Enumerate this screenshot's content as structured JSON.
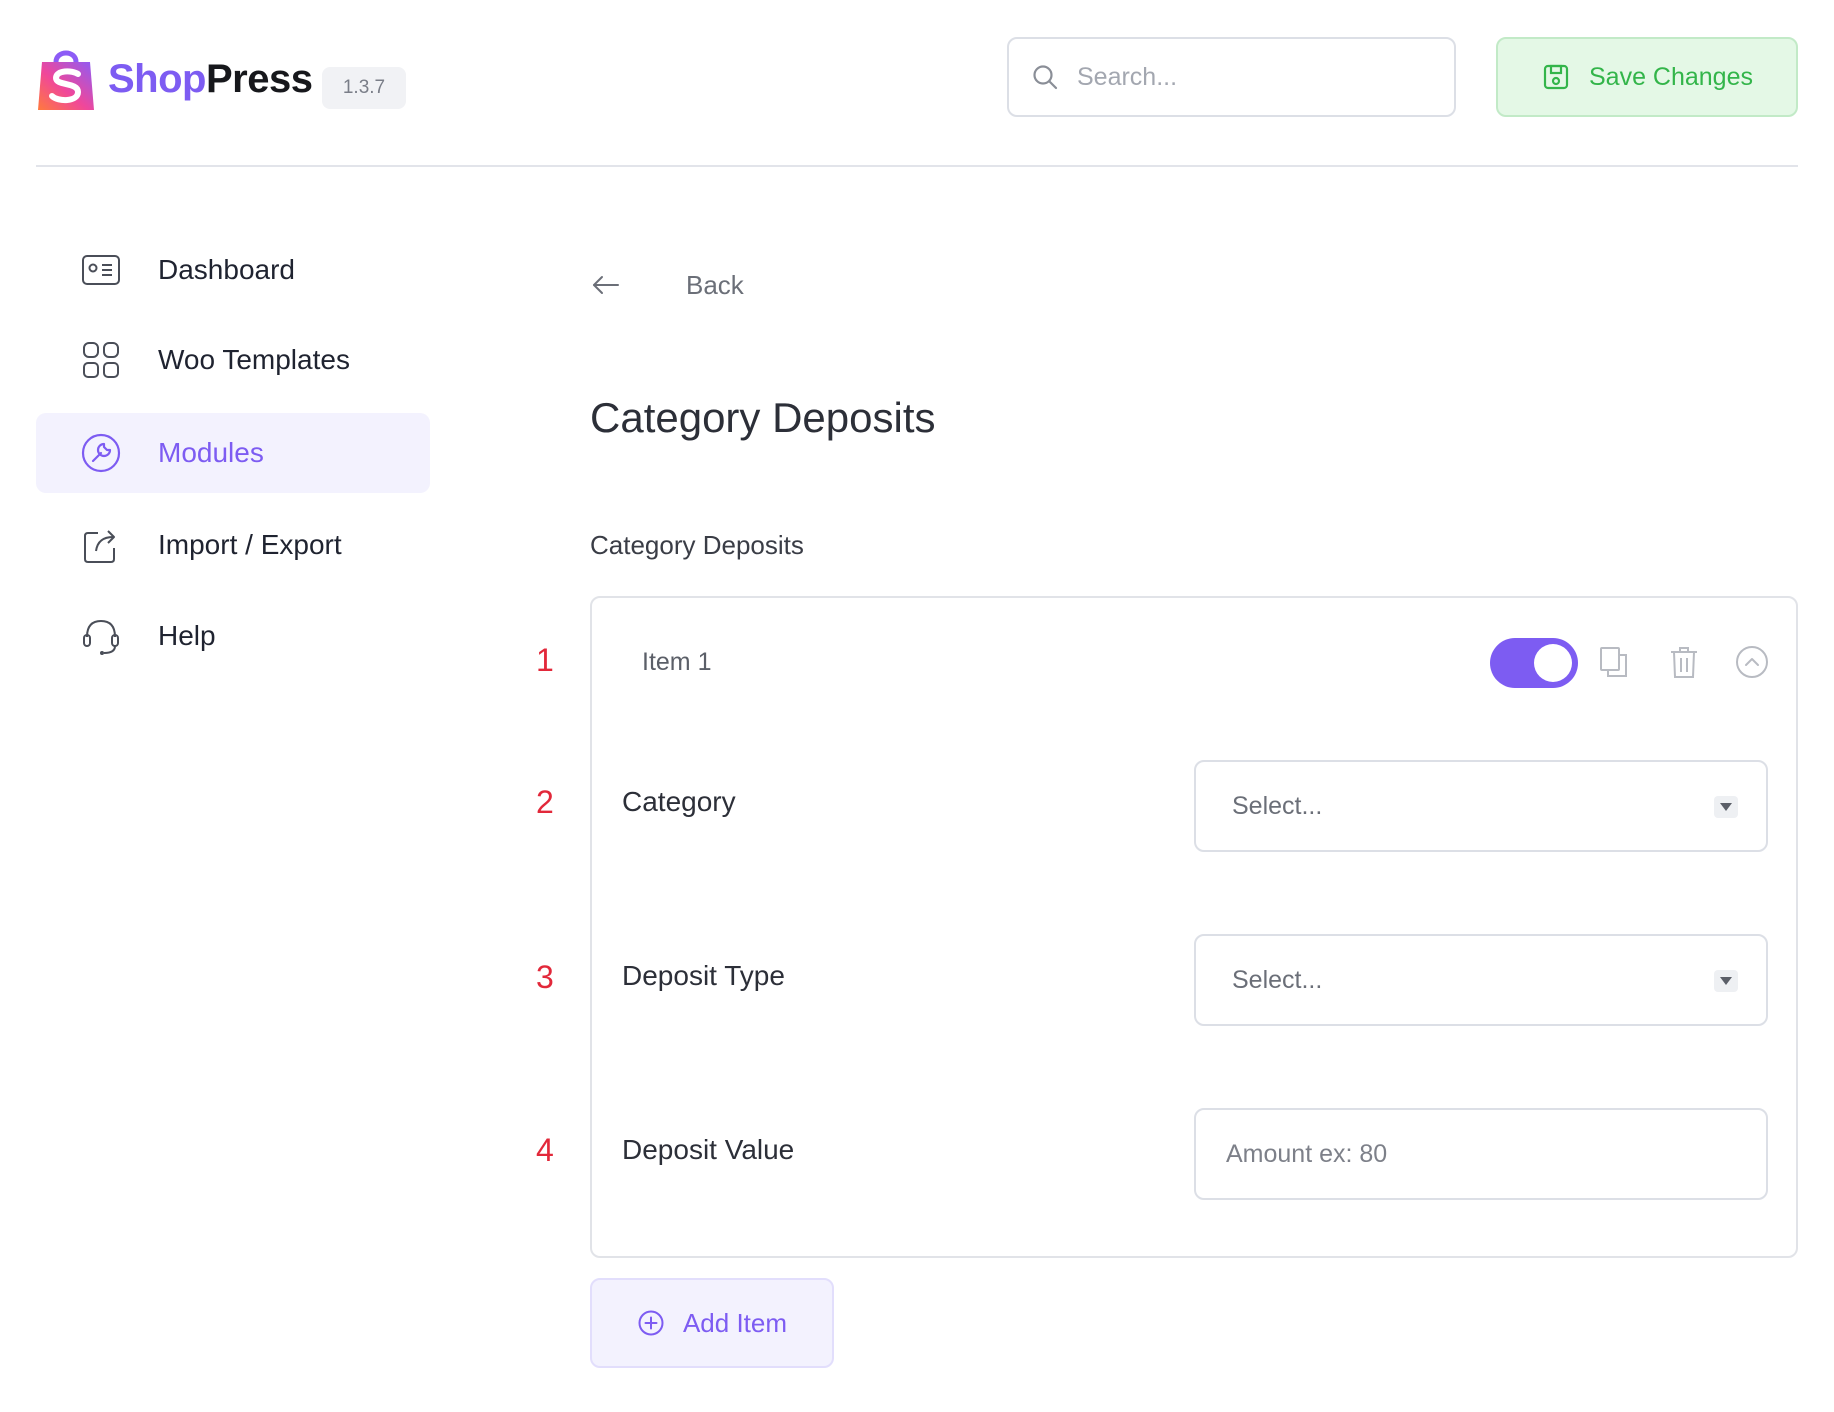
{
  "app": {
    "brand_part1": "Shop",
    "brand_part2": "Press",
    "version": "1.3.7",
    "logo_icon": "shopping-bag-s-icon",
    "brand_color": "#7d5cf2"
  },
  "header": {
    "search_placeholder": "Search...",
    "search_icon": "search-icon",
    "save_label": "Save Changes",
    "save_icon": "floppy-disk-icon",
    "save_color": "#33b54a"
  },
  "sidebar": {
    "items": [
      {
        "label": "Dashboard",
        "icon": "id-card-icon",
        "active": false
      },
      {
        "label": "Woo Templates",
        "icon": "grid-icon",
        "active": false
      },
      {
        "label": "Modules",
        "icon": "wrench-circle-icon",
        "active": true
      },
      {
        "label": "Import / Export",
        "icon": "export-icon",
        "active": false
      },
      {
        "label": "Help",
        "icon": "headset-icon",
        "active": false
      }
    ]
  },
  "main": {
    "back_label": "Back",
    "back_icon": "arrow-left-icon",
    "page_title": "Category Deposits",
    "section_label": "Category Deposits",
    "callouts": [
      "1",
      "2",
      "3",
      "4"
    ],
    "callout_color": "#e2283a",
    "repeater": {
      "item_title": "Item 1",
      "enabled": true,
      "actions": [
        "toggle-switch",
        "duplicate-icon",
        "trash-icon",
        "chevron-up-circle-icon"
      ],
      "fields": {
        "category": {
          "label": "Category",
          "value": "Select..."
        },
        "deposit_type": {
          "label": "Deposit Type",
          "value": "Select..."
        },
        "deposit_value": {
          "label": "Deposit Value",
          "placeholder": "Amount ex: 80"
        }
      }
    },
    "add_item_label": "Add Item",
    "add_item_icon": "plus-circle-icon"
  }
}
